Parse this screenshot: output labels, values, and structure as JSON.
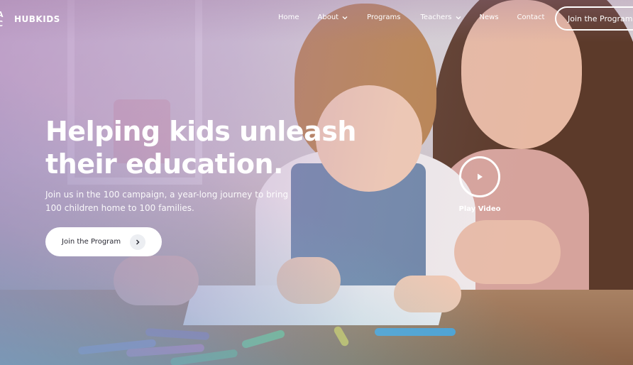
{
  "brand": {
    "name": "HUBKIDS",
    "mark_letters": [
      "A",
      "C"
    ]
  },
  "nav": {
    "items": [
      {
        "label": "Home",
        "dropdown": false
      },
      {
        "label": "About",
        "dropdown": true
      },
      {
        "label": "Programs",
        "dropdown": false
      },
      {
        "label": "Teachers",
        "dropdown": true
      },
      {
        "label": "News",
        "dropdown": false
      },
      {
        "label": "Contact",
        "dropdown": false
      }
    ],
    "cta_label": "Join the Program"
  },
  "hero": {
    "title_line1": "Helping kids unleash",
    "title_line2": "their education.",
    "subtitle_line1": "Join us in the 100 campaign, a year-long journey to bring",
    "subtitle_line2": "100 children home to 100 families.",
    "cta_label": "Join the Program",
    "cta_icon": "chevron-right-icon",
    "video_label": "Play Video",
    "video_icon": "play-icon"
  },
  "colors": {
    "accent_teal": "#40c4be",
    "accent_purple": "#aa78be",
    "button_text": "#2b2b35"
  }
}
